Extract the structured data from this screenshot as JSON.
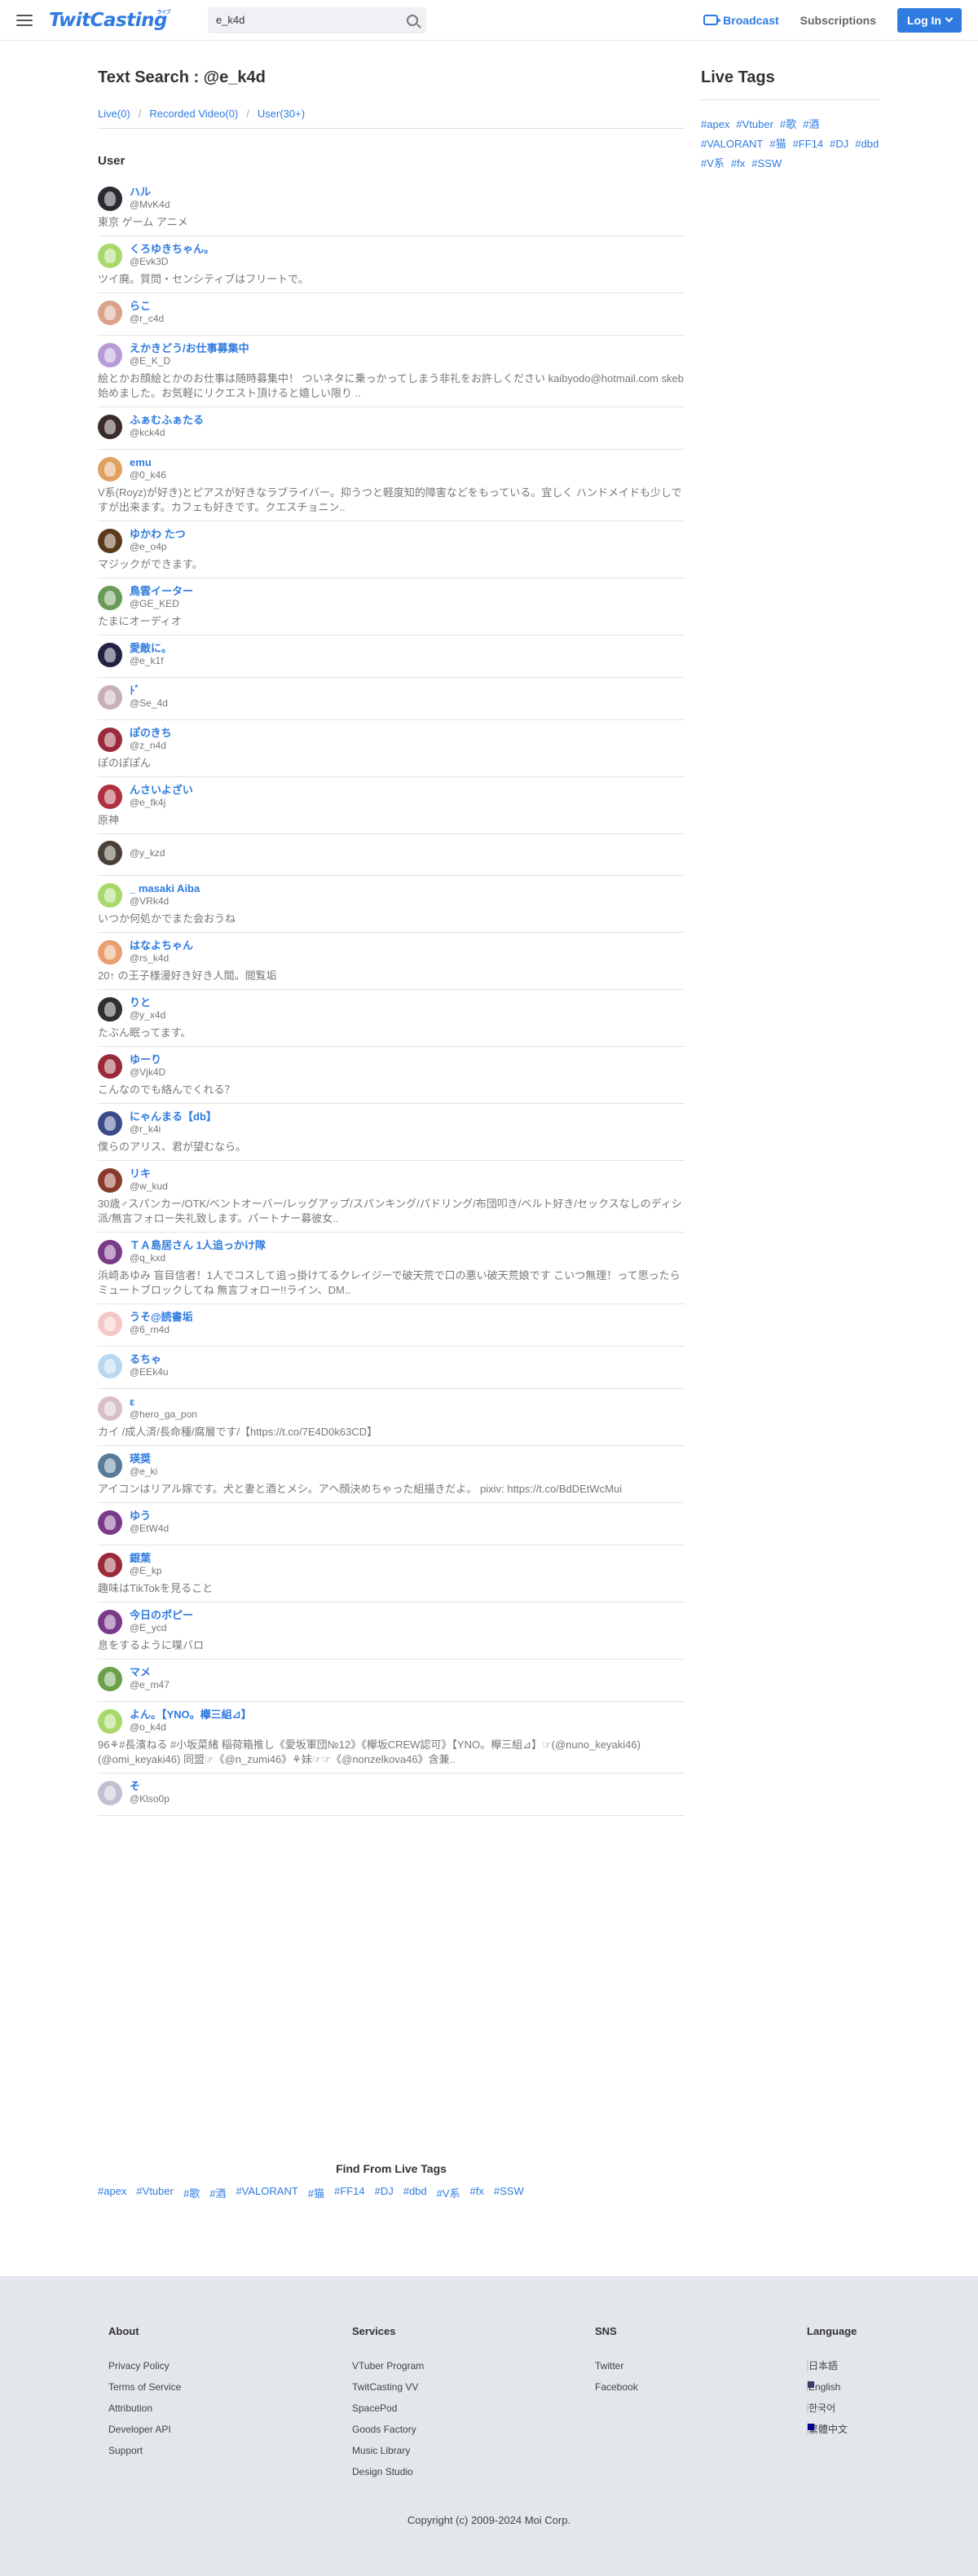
{
  "header": {
    "logo": "TwitCasting",
    "logo_sup": "ライブ",
    "search_value": "e_k4d",
    "broadcast": "Broadcast",
    "subscriptions": "Subscriptions",
    "login": "Log In"
  },
  "main": {
    "title": "Text Search : @e_k4d",
    "tabs": [
      "Live(0)",
      "Recorded Video(0)",
      "User(30+)"
    ],
    "section": "User",
    "users": [
      {
        "name": "ハル",
        "id": "@MvK4d",
        "desc": "東京 ゲーム アニメ",
        "avatar": "#2b2b33"
      },
      {
        "name": "くろゆきちゃん。",
        "id": "@Evk3D",
        "desc": "ツイ廃。質問・センシティブはフリートで。",
        "avatar": "#a8d86a"
      },
      {
        "name": "らこ",
        "id": "@r_c4d",
        "desc": "",
        "avatar": "#d9a38a"
      },
      {
        "name": "えかきどう/お仕事募集中",
        "id": "@E_K_D",
        "desc": "絵とかお顔絵とかのお仕事は随時募集中！ ついネタに乗っかってしまう非礼をお許しください kaibyodo@hotmail.com skeb始めました。お気軽にリクエスト頂けると嬉しい限り ..",
        "avatar": "#b79ad6"
      },
      {
        "name": "ふぁむふぁたる",
        "id": "@kck4d",
        "desc": "",
        "avatar": "#3a2a2a"
      },
      {
        "name": "emu",
        "id": "@0_k46",
        "desc": "V系(Royz)が好き)とピアスが好きなラブライバー。抑うつと軽度知的障害などをもっている。宜しく ハンドメイドも少しですが出来ます。カフェも好きです。クエスチョニン..",
        "avatar": "#e0a060"
      },
      {
        "name": "ゆかわ たつ",
        "id": "@e_o4p",
        "desc": "マジックができます。",
        "avatar": "#5a3a1a"
      },
      {
        "name": "鳥雲イーター",
        "id": "@GE_KED",
        "desc": "たまにオーディオ",
        "avatar": "#6a9a5a"
      },
      {
        "name": "愛敵に。",
        "id": "@e_k1f",
        "desc": "",
        "avatar": "#222244"
      },
      {
        "name": "ﾄﾞ",
        "id": "@Se_4d",
        "desc": "",
        "avatar": "#c8b0b8"
      },
      {
        "name": "ぽのきち",
        "id": "@z_n4d",
        "desc": "ぽのぽぽん",
        "avatar": "#9a2a3a"
      },
      {
        "name": "んさいよざい",
        "id": "@e_fk4j",
        "desc": "原神",
        "avatar": "#b03040"
      },
      {
        "name": "",
        "id": "@y_kzd",
        "desc": "",
        "avatar": "#4a4038"
      },
      {
        "name": "_ masaki Aiba",
        "id": "@VRk4d",
        "desc": "いつか何処かでまた会おうね",
        "avatar": "#a8d86a"
      },
      {
        "name": "はなよちゃん",
        "id": "@rs_k4d",
        "desc": "20↑ の王子様漫好き好き人間。閲覧垢",
        "avatar": "#e8a070"
      },
      {
        "name": "りと",
        "id": "@y_x4d",
        "desc": "たぶん眠ってます。",
        "avatar": "#303030"
      },
      {
        "name": "ゆーり",
        "id": "@Vjk4D",
        "desc": "こんなのでも絡んでくれる？",
        "avatar": "#9a2a3a"
      },
      {
        "name": "にゃんまる【db】",
        "id": "@r_k4i",
        "desc": "僕らのアリス、君が望むなら。",
        "avatar": "#3a4a8a"
      },
      {
        "name": "リキ",
        "id": "@w_kud",
        "desc": "30歳♂スパンカー/OTK/ベントオーバー/レッグアップ/スパンキング/パドリング/布団叩き/ベルト好き/セックスなしのディシ派/無言フォロー失礼致します。パートナー募彼女..",
        "avatar": "#8a3a2a"
      },
      {
        "name": "ＴＡ島居さん 1人追っかけ隊",
        "id": "@q_kxd",
        "desc": "浜崎あゆみ 盲目信者！1人でコスして追っ掛けてるクレイジーで破天荒で口の悪い破天荒娘です こいつ無理！って思ったらミュートブロックしてね 無言フォロー!!ライン、DM..",
        "avatar": "#7a3a8a"
      },
      {
        "name": "うそ@読書垢",
        "id": "@6_m4d",
        "desc": "",
        "avatar": "#f5c8c8"
      },
      {
        "name": "るちゃ",
        "id": "@EEk4u",
        "desc": "",
        "avatar": "#b8d8f0"
      },
      {
        "name": "ε",
        "id": "@hero_ga_pon",
        "desc": "カイ /成人済/長命種/腐層です/【https://t.co/7E4D0k63CD】",
        "avatar": "#d8c0c8"
      },
      {
        "name": "瑛奨",
        "id": "@e_ki",
        "desc": "アイコンはリアル嫁です。犬と妻と酒とメシ。アヘ顔決めちゃった組描きだよ。 pixiv: https://t.co/BdDEtWcMui",
        "avatar": "#5a7a9a"
      },
      {
        "name": "ゆう",
        "id": "@EtW4d",
        "desc": "",
        "avatar": "#7a3a8a"
      },
      {
        "name": "銀葉",
        "id": "@E_kp",
        "desc": "趣味はTikTokを見ること",
        "avatar": "#9a2a3a"
      },
      {
        "name": "今日のポピー",
        "id": "@E_ycd",
        "desc": "息をするように喋バロ",
        "avatar": "#7a3a8a"
      },
      {
        "name": "マメ",
        "id": "@e_m47",
        "desc": "",
        "avatar": "#6aa04a"
      },
      {
        "name": "よん。【YNO。欅三組⊿】",
        "id": "@o_k4d",
        "desc": "96⚘#長濱ねる #小坂菜緒 稲荷箱推し《愛坂軍団№12》《欅坂CREW認可》【YNO。欅三組⊿】☞(@nuno_keyaki46)(@omi_keyaki46) 同盟☞《@n_zumi46》⚘妹☞☞《@nonzelkova46》含兼..",
        "avatar": "#a8d86a"
      },
      {
        "name": "そ",
        "id": "@Klso0p",
        "desc": "",
        "avatar": "#c0c0d0"
      }
    ]
  },
  "side": {
    "title": "Live Tags",
    "tags": [
      "#apex",
      "#Vtuber",
      "#歌",
      "#酒",
      "#VALORANT",
      "#猫",
      "#FF14",
      "#DJ",
      "#dbd",
      "#V系",
      "#fx",
      "#SSW"
    ]
  },
  "find": {
    "title": "Find From Live Tags",
    "tags": [
      "#apex",
      "#Vtuber",
      "#歌",
      "#酒",
      "#VALORANT",
      "#猫",
      "#FF14",
      "#DJ",
      "#dbd",
      "#V系",
      "#fx",
      "#SSW"
    ]
  },
  "footer": {
    "about": {
      "title": "About",
      "links": [
        "Privacy Policy",
        "Terms of Service",
        "Attribution",
        "Developer API",
        "Support"
      ]
    },
    "services": {
      "title": "Services",
      "links": [
        "VTuber Program",
        "TwitCasting VV",
        "SpacePod",
        "Goods Factory",
        "Music Library",
        "Design Studio"
      ]
    },
    "sns": {
      "title": "SNS",
      "links": [
        "Twitter",
        "Facebook"
      ]
    },
    "language": {
      "title": "Language",
      "items": [
        "日本語",
        "English",
        "한국어",
        "繁體中文"
      ]
    },
    "copyright": "Copyright (c) 2009-2024 Moi Corp."
  }
}
